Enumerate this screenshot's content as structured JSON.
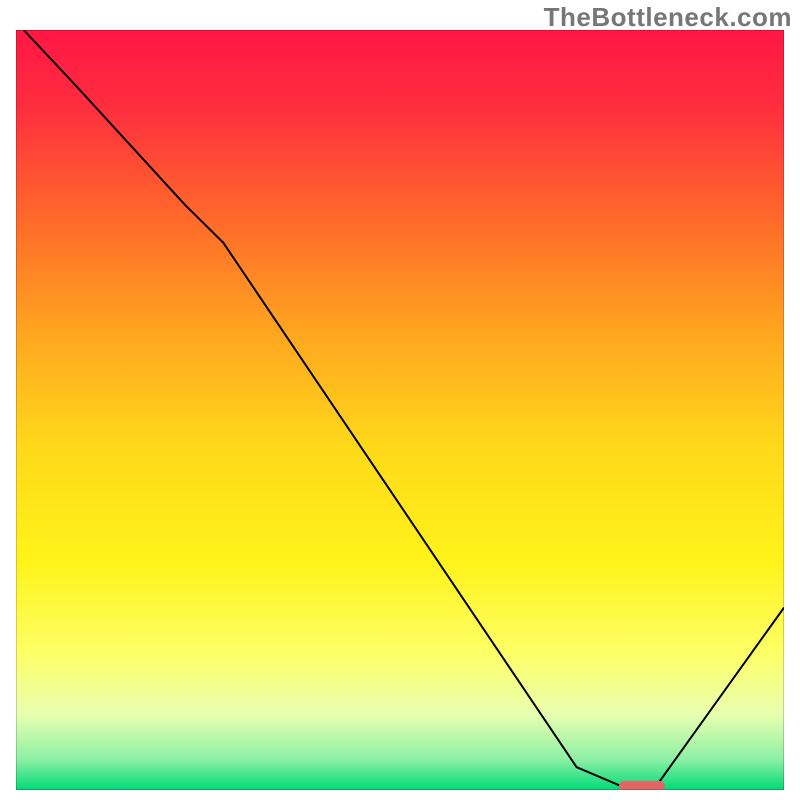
{
  "watermark": "TheBottleneck.com",
  "chart_data": {
    "type": "line",
    "title": "",
    "xlabel": "",
    "ylabel": "",
    "xlim": [
      0,
      100
    ],
    "ylim": [
      0,
      100
    ],
    "background_gradient": {
      "stops": [
        {
          "pos": 0.0,
          "color": "#ff1744"
        },
        {
          "pos": 0.1,
          "color": "#ff2d3f"
        },
        {
          "pos": 0.25,
          "color": "#ff6a2a"
        },
        {
          "pos": 0.4,
          "color": "#ffa61f"
        },
        {
          "pos": 0.55,
          "color": "#ffd91a"
        },
        {
          "pos": 0.7,
          "color": "#fff31a"
        },
        {
          "pos": 0.82,
          "color": "#fdff66"
        },
        {
          "pos": 0.9,
          "color": "#e9ffb0"
        },
        {
          "pos": 0.96,
          "color": "#8cf0a4"
        },
        {
          "pos": 1.0,
          "color": "#00d977"
        }
      ]
    },
    "curve": {
      "name": "bottleneck-curve",
      "x": [
        1,
        7.5,
        22,
        27,
        73,
        80,
        83,
        100
      ],
      "y": [
        100,
        93,
        77,
        72,
        3,
        0,
        0,
        24
      ]
    },
    "marker": {
      "name": "optimal-range",
      "x0": 78.5,
      "x1": 84.5,
      "y": 0.5,
      "color": "#e06666"
    }
  }
}
